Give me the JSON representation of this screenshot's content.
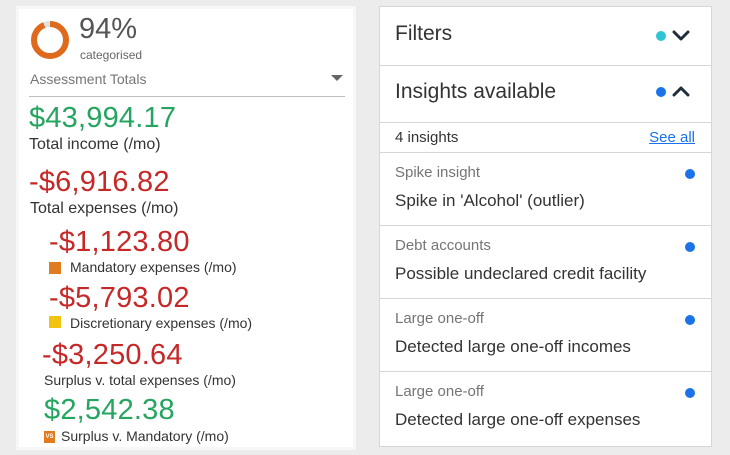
{
  "colors": {
    "ring_progress": "#e06a1b",
    "ring_track": "#e0e0e0",
    "positive": "#25a55f",
    "negative": "#c62828",
    "mandatory": "#e07b1f",
    "discretionary": "#f2c40f",
    "filters_dot": "#2ec4d6",
    "insight_dot": "#1a73e8",
    "chevron": "#1f2d3d"
  },
  "assessment": {
    "categorised_percent": "94%",
    "categorised_fraction": 0.94,
    "categorised_label": "categorised",
    "dropdown_label": "Assessment Totals",
    "income": {
      "amount": "$43,994.17",
      "label": "Total income (/mo)"
    },
    "expenses": {
      "amount": "-$6,916.82",
      "label": "Total expenses (/mo)"
    },
    "mandatory": {
      "amount": "-$1,123.80",
      "label": "Mandatory expenses (/mo)"
    },
    "discretionary": {
      "amount": "-$5,793.02",
      "label": "Discretionary expenses (/mo)"
    },
    "surplus_total": {
      "amount": "-$3,250.64",
      "label": "Surplus v. total expenses (/mo)"
    },
    "surplus_mandatory": {
      "amount": "$2,542.38",
      "label": "Surplus v. Mandatory  (/mo)",
      "icon_text": "VS"
    }
  },
  "filters": {
    "title": "Filters",
    "icon": "chevron-down-icon"
  },
  "insights": {
    "title": "Insights available",
    "icon": "chevron-up-icon",
    "count_label": "4 insights",
    "see_all": "See all",
    "items": [
      {
        "category": "Spike insight",
        "title": "Spike in 'Alcohol' (outlier)"
      },
      {
        "category": "Debt accounts",
        "title": "Possible undeclared credit facility"
      },
      {
        "category": "Large one-off",
        "title": "Detected large one-off incomes"
      },
      {
        "category": "Large one-off",
        "title": "Detected large one-off expenses"
      }
    ]
  }
}
